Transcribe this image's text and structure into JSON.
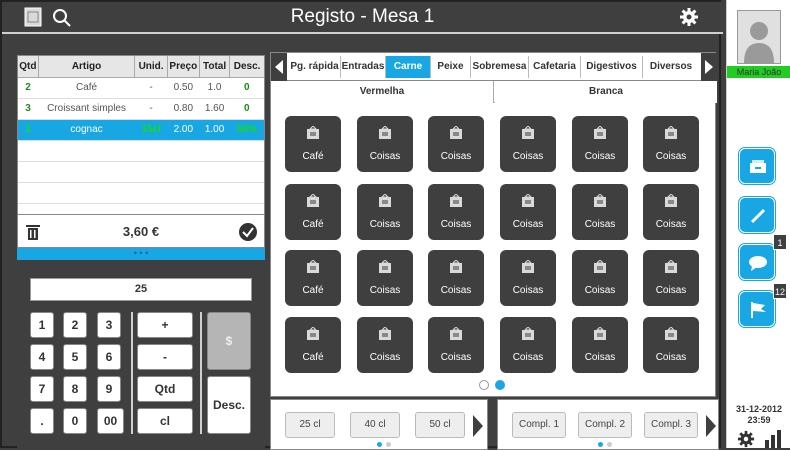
{
  "header": {
    "title": "Registo - Mesa 1"
  },
  "order_table": {
    "columns": [
      "Qtd",
      "Artigo",
      "Unid.",
      "Preço",
      "Total",
      "Desc."
    ],
    "rows": [
      {
        "qtd": "2",
        "artigo": "Café",
        "unid": "-",
        "preco": "0.50",
        "total": "1.0",
        "desc": "0"
      },
      {
        "qtd": "3",
        "artigo": "Croissant simples",
        "unid": "-",
        "preco": "0.80",
        "total": "1.60",
        "desc": "0"
      },
      {
        "qtd": "1",
        "artigo": "cognac",
        "unid": "15cl",
        "preco": "2.00",
        "total": "1.00",
        "desc": "50%"
      }
    ]
  },
  "total": "3,60 €",
  "numpad": {
    "display": "25",
    "keys": [
      "1",
      "2",
      "3",
      "4",
      "5",
      "6",
      "7",
      "8",
      "9",
      ".",
      "0",
      "00"
    ],
    "plus": "+",
    "minus": "-",
    "qtd": "Qtd",
    "cl": "cl",
    "dollar": "$",
    "desc": "Desc."
  },
  "tabs": [
    "Pg. rápida",
    "Entradas",
    "Carne",
    "Peixe",
    "Sobremesa",
    "Cafetaria",
    "Digestivos",
    "Diversos"
  ],
  "subtabs": [
    "Vermelha",
    "Branca"
  ],
  "products": [
    "Café",
    "Coisas",
    "Coisas",
    "Coisas",
    "Coisas",
    "Coisas",
    "Café",
    "Coisas",
    "Coisas",
    "Coisas",
    "Coisas",
    "Coisas",
    "Café",
    "Coisas",
    "Coisas",
    "Coisas",
    "Coisas",
    "Coisas",
    "Café",
    "Coisas",
    "Coisas",
    "Coisas",
    "Coisas",
    "Coisas"
  ],
  "volumes": [
    "25 cl",
    "40 cl",
    "50 cl"
  ],
  "complements": [
    "Compl. 1",
    "Compl. 2",
    "Compl. 3"
  ],
  "side": {
    "user": "Maria João",
    "badge_messages": "1",
    "badge_flags": "12",
    "date": "31-12-2012",
    "time": "23:59"
  },
  "colors": {
    "accent": "#19a7e3",
    "dark": "#3f3f3f",
    "green": "#22cc22"
  }
}
